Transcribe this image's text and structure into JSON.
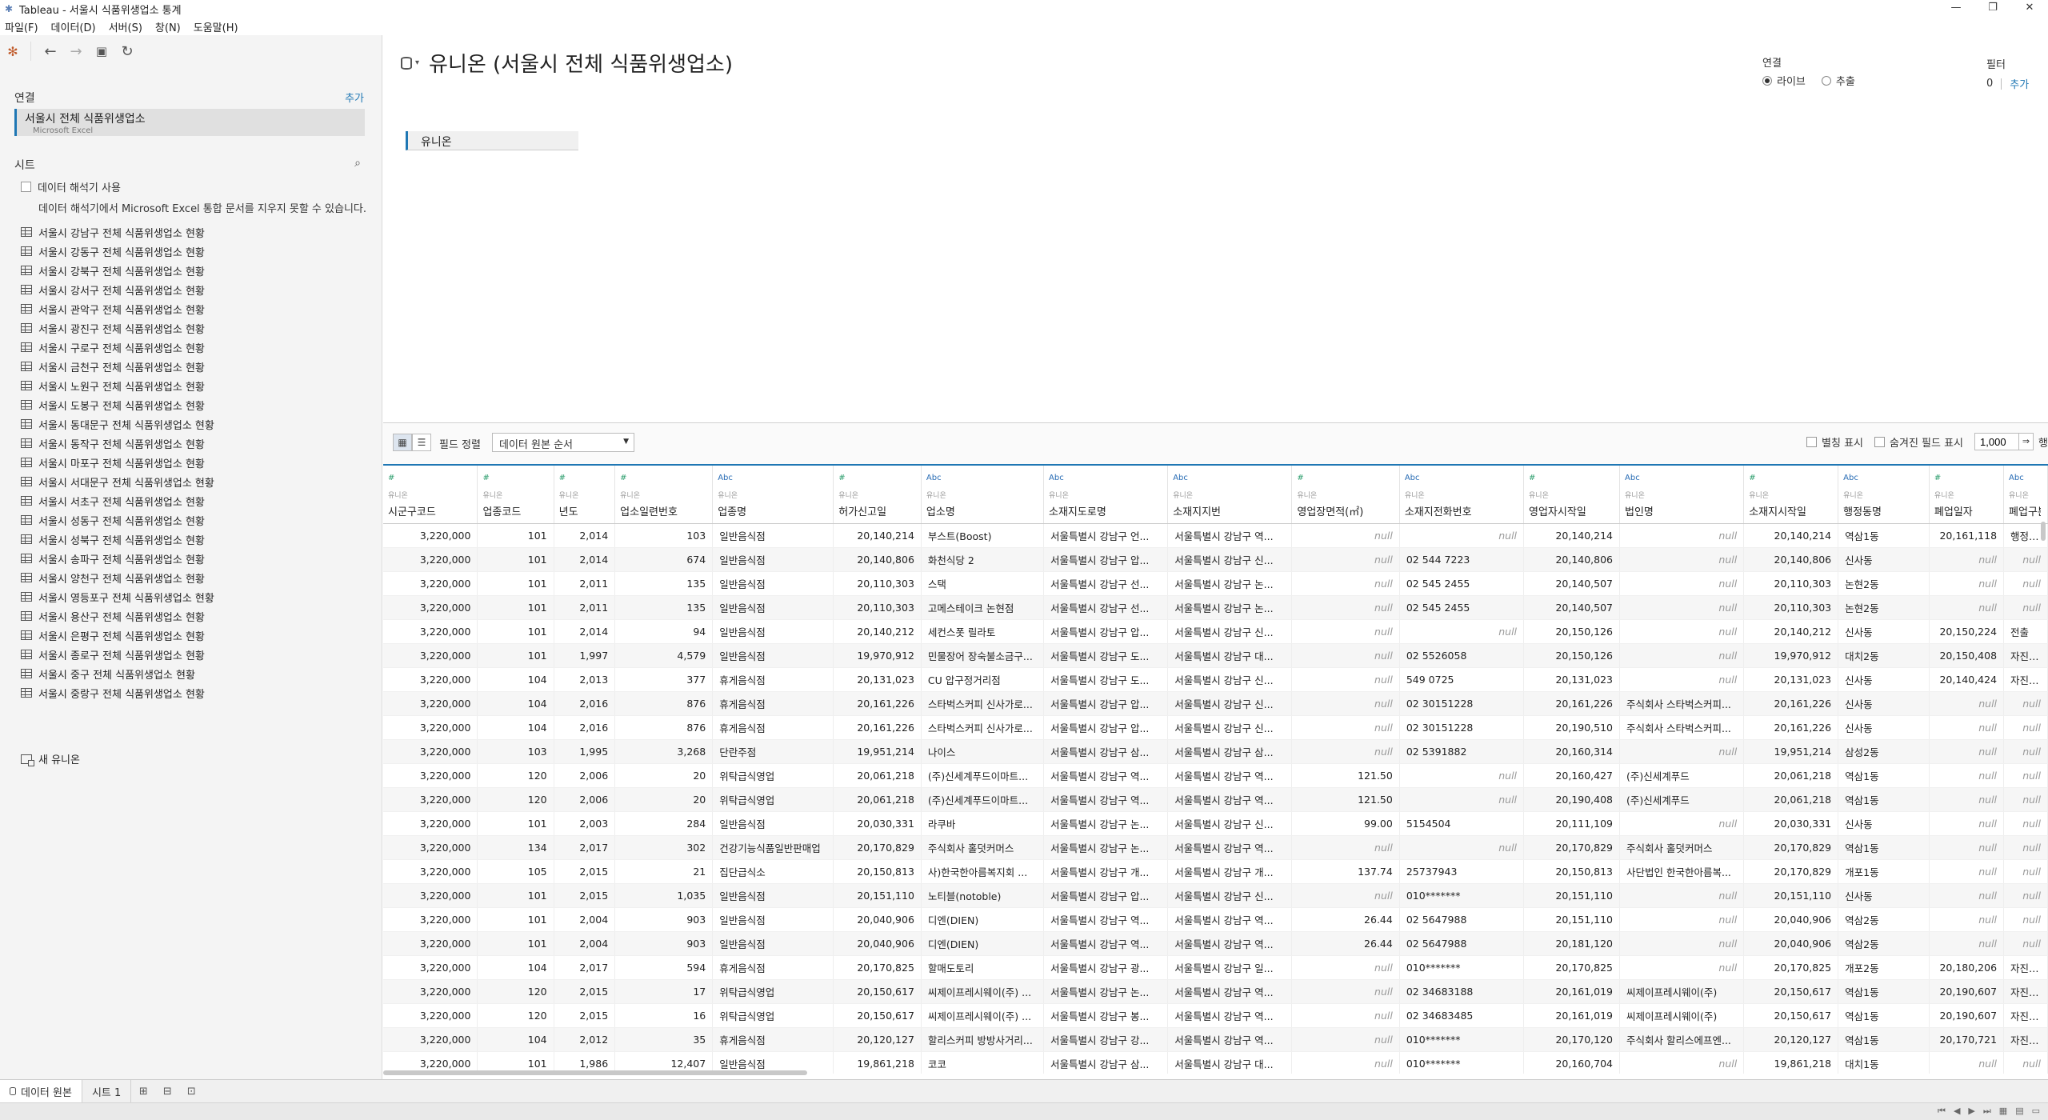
{
  "window": {
    "title": "Tableau - 서울시 식품위생업소 통계"
  },
  "menu": [
    "파일(F)",
    "데이터(D)",
    "서버(S)",
    "창(N)",
    "도움말(H)"
  ],
  "left": {
    "connections_header": "연결",
    "add_label": "추가",
    "connection": {
      "name": "서울시 전체 식품위생업소",
      "type": "Microsoft Excel"
    },
    "sheets_header": "시트",
    "interpreter_label": "데이터 해석기 사용",
    "interpreter_desc": "데이터 해석기에서 Microsoft Excel 통합 문서를 지우지 못할 수 있습니다.",
    "sheets": [
      "서울시 강남구 전체 식품위생업소 현황",
      "서울시 강동구 전체 식품위생업소 현황",
      "서울시 강북구 전체 식품위생업소 현황",
      "서울시 강서구 전체 식품위생업소 현황",
      "서울시 관악구 전체 식품위생업소 현황",
      "서울시 광진구 전체 식품위생업소 현황",
      "서울시 구로구 전체 식품위생업소 현황",
      "서울시 금천구 전체 식품위생업소 현황",
      "서울시 노원구 전체 식품위생업소 현황",
      "서울시 도봉구 전체 식품위생업소 현황",
      "서울시 동대문구 전체 식품위생업소 현황",
      "서울시 동작구 전체 식품위생업소 현황",
      "서울시 마포구 전체 식품위생업소 현황",
      "서울시 서대문구 전체 식품위생업소 현황",
      "서울시 서초구 전체 식품위생업소 현황",
      "서울시 성동구 전체 식품위생업소 현황",
      "서울시 성북구 전체 식품위생업소 현황",
      "서울시 송파구 전체 식품위생업소 현황",
      "서울시 양천구 전체 식품위생업소 현황",
      "서울시 영등포구 전체 식품위생업소 현황",
      "서울시 용산구 전체 식품위생업소 현황",
      "서울시 은평구 전체 식품위생업소 현황",
      "서울시 종로구 전체 식품위생업소 현황",
      "서울시 중구 전체 식품위생업소 현황",
      "서울시 중랑구 전체 식품위생업소 현황"
    ],
    "new_union": "새 유니온"
  },
  "canvas": {
    "title": "유니온 (서울시 전체 식품위생업소)",
    "connection_label": "연결",
    "live_label": "라이브",
    "extract_label": "추출",
    "filters_label": "필터",
    "filters_count": "0",
    "filters_add": "추가",
    "union_pill": "유니온"
  },
  "grid_toolbar": {
    "sort_label": "필드 정렬",
    "sort_value": "데이터 원본 순서",
    "show_alias": "별칭 표시",
    "show_hidden": "숨겨진 필드 표시",
    "rows_value": "1,000",
    "rows_label": "행"
  },
  "grid": {
    "columns": [
      {
        "type": "#",
        "source": "유니온",
        "name": "시군구코드"
      },
      {
        "type": "#",
        "source": "유니온",
        "name": "업종코드"
      },
      {
        "type": "#",
        "source": "유니온",
        "name": "년도"
      },
      {
        "type": "#",
        "source": "유니온",
        "name": "업소일련번호"
      },
      {
        "type": "Abc",
        "source": "유니온",
        "name": "업종명"
      },
      {
        "type": "#",
        "source": "유니온",
        "name": "허가신고일"
      },
      {
        "type": "Abc",
        "source": "유니온",
        "name": "업소명"
      },
      {
        "type": "Abc",
        "source": "유니온",
        "name": "소재지도로명"
      },
      {
        "type": "Abc",
        "source": "유니온",
        "name": "소재지지번"
      },
      {
        "type": "#",
        "source": "유니온",
        "name": "영업장면적(㎡)"
      },
      {
        "type": "Abc",
        "source": "유니온",
        "name": "소재지전화번호"
      },
      {
        "type": "#",
        "source": "유니온",
        "name": "영업자시작일"
      },
      {
        "type": "Abc",
        "source": "유니온",
        "name": "법인명"
      },
      {
        "type": "#",
        "source": "유니온",
        "name": "소재지시작일"
      },
      {
        "type": "Abc",
        "source": "유니온",
        "name": "행정동명"
      },
      {
        "type": "#",
        "source": "유니온",
        "name": "폐업일자"
      },
      {
        "type": "Abc",
        "source": "유니온",
        "name": "폐업구분"
      }
    ],
    "rows": [
      [
        "3,220,000",
        "101",
        "2,014",
        "103",
        "일반음식점",
        "20,140,214",
        "부스트(Boost)",
        "서울특별시 강남구 언...",
        "서울특별시 강남구 역...",
        "null",
        "null",
        "20,140,214",
        "null",
        "20,140,214",
        "역삼1동",
        "20,161,118",
        "행정처분"
      ],
      [
        "3,220,000",
        "101",
        "2,014",
        "674",
        "일반음식점",
        "20,140,806",
        "화천식당 2",
        "서울특별시 강남구 압...",
        "서울특별시 강남구 신...",
        "null",
        "02 544 7223",
        "20,140,806",
        "null",
        "20,140,806",
        "신사동",
        "null",
        "null"
      ],
      [
        "3,220,000",
        "101",
        "2,011",
        "135",
        "일반음식점",
        "20,110,303",
        "스택",
        "서울특별시 강남구 선...",
        "서울특별시 강남구 논...",
        "null",
        "02 545 2455",
        "20,140,507",
        "null",
        "20,110,303",
        "논현2동",
        "null",
        "null"
      ],
      [
        "3,220,000",
        "101",
        "2,011",
        "135",
        "일반음식점",
        "20,110,303",
        "고메스테이크 논현점",
        "서울특별시 강남구 선...",
        "서울특별시 강남구 논...",
        "null",
        "02 545 2455",
        "20,140,507",
        "null",
        "20,110,303",
        "논현2동",
        "null",
        "null"
      ],
      [
        "3,220,000",
        "101",
        "2,014",
        "94",
        "일반음식점",
        "20,140,212",
        "세컨스폿 릴라토",
        "서울특별시 강남구 압...",
        "서울특별시 강남구 신...",
        "null",
        "null",
        "20,150,126",
        "null",
        "20,140,212",
        "신사동",
        "20,150,224",
        "전출"
      ],
      [
        "3,220,000",
        "101",
        "1,997",
        "4,579",
        "일반음식점",
        "19,970,912",
        "민물장어 장숙불소금구...",
        "서울특별시 강남구 도...",
        "서울특별시 강남구 대...",
        "null",
        "02 5526058",
        "20,150,126",
        "null",
        "19,970,912",
        "대치2동",
        "20,150,408",
        "자진폐업"
      ],
      [
        "3,220,000",
        "104",
        "2,013",
        "377",
        "휴게음식점",
        "20,131,023",
        "CU 압구정거리점",
        "서울특별시 강남구 도...",
        "서울특별시 강남구 신...",
        "null",
        "549 0725",
        "20,131,023",
        "null",
        "20,131,023",
        "신사동",
        "20,140,424",
        "자진폐업"
      ],
      [
        "3,220,000",
        "104",
        "2,016",
        "876",
        "휴게음식점",
        "20,161,226",
        "스타벅스커피 신사가로...",
        "서울특별시 강남구 압...",
        "서울특별시 강남구 신...",
        "null",
        "02  30151228",
        "20,161,226",
        "주식회사 스타벅스커피...",
        "20,161,226",
        "신사동",
        "null",
        "null"
      ],
      [
        "3,220,000",
        "104",
        "2,016",
        "876",
        "휴게음식점",
        "20,161,226",
        "스타벅스커피 신사가로...",
        "서울특별시 강남구 압...",
        "서울특별시 강남구 신...",
        "null",
        "02  30151228",
        "20,190,510",
        "주식회사 스타벅스커피...",
        "20,161,226",
        "신사동",
        "null",
        "null"
      ],
      [
        "3,220,000",
        "103",
        "1,995",
        "3,268",
        "단란주점",
        "19,951,214",
        "나이스",
        "서울특별시 강남구 삼...",
        "서울특별시 강남구 삼...",
        "null",
        "02  5391882",
        "20,160,314",
        "null",
        "19,951,214",
        "삼성2동",
        "null",
        "null"
      ],
      [
        "3,220,000",
        "120",
        "2,006",
        "20",
        "위탁급식영업",
        "20,061,218",
        "(주)신세계푸드이마트...",
        "서울특별시 강남구 역...",
        "서울특별시 강남구 역...",
        "121.50",
        "null",
        "20,160,427",
        "(주)신세계푸드",
        "20,061,218",
        "역삼1동",
        "null",
        "null"
      ],
      [
        "3,220,000",
        "120",
        "2,006",
        "20",
        "위탁급식영업",
        "20,061,218",
        "(주)신세계푸드이마트...",
        "서울특별시 강남구 역...",
        "서울특별시 강남구 역...",
        "121.50",
        "null",
        "20,190,408",
        "(주)신세계푸드",
        "20,061,218",
        "역삼1동",
        "null",
        "null"
      ],
      [
        "3,220,000",
        "101",
        "2,003",
        "284",
        "일반음식점",
        "20,030,331",
        "라쿠바",
        "서울특별시 강남구 논...",
        "서울특별시 강남구 신...",
        "99.00",
        "5154504",
        "20,111,109",
        "null",
        "20,030,331",
        "신사동",
        "null",
        "null"
      ],
      [
        "3,220,000",
        "134",
        "2,017",
        "302",
        "건강기능식품일반판매업",
        "20,170,829",
        "주식회사 홀덧커머스",
        "서울특별시 강남구 논...",
        "서울특별시 강남구 역...",
        "null",
        "null",
        "20,170,829",
        "주식회사 홀덧커머스",
        "20,170,829",
        "역삼1동",
        "null",
        "null"
      ],
      [
        "3,220,000",
        "105",
        "2,015",
        "21",
        "집단급식소",
        "20,150,813",
        "사)한국한아름복지회 ...",
        "서울특별시 강남구 개...",
        "서울특별시 강남구 개...",
        "137.74",
        "25737943",
        "20,150,813",
        "사단법인 한국한아름복...",
        "20,170,829",
        "개포1동",
        "null",
        "null"
      ],
      [
        "3,220,000",
        "101",
        "2,015",
        "1,035",
        "일반음식점",
        "20,151,110",
        "노티블(notoble)",
        "서울특별시 강남구 압...",
        "서울특별시 강남구 신...",
        "null",
        "010*******",
        "20,151,110",
        "null",
        "20,151,110",
        "신사동",
        "null",
        "null"
      ],
      [
        "3,220,000",
        "101",
        "2,004",
        "903",
        "일반음식점",
        "20,040,906",
        "디엔(DIEN)",
        "서울특별시 강남구 역...",
        "서울특별시 강남구 역...",
        "26.44",
        "02  5647988",
        "20,151,110",
        "null",
        "20,040,906",
        "역삼2동",
        "null",
        "null"
      ],
      [
        "3,220,000",
        "101",
        "2,004",
        "903",
        "일반음식점",
        "20,040,906",
        "디엔(DIEN)",
        "서울특별시 강남구 역...",
        "서울특별시 강남구 역...",
        "26.44",
        "02  5647988",
        "20,181,120",
        "null",
        "20,040,906",
        "역삼2동",
        "null",
        "null"
      ],
      [
        "3,220,000",
        "104",
        "2,017",
        "594",
        "휴게음식점",
        "20,170,825",
        "할매도토리",
        "서울특별시 강남구 광...",
        "서울특별시 강남구 일...",
        "null",
        "010*******",
        "20,170,825",
        "null",
        "20,170,825",
        "개포2동",
        "20,180,206",
        "자진폐업"
      ],
      [
        "3,220,000",
        "120",
        "2,015",
        "17",
        "위탁급식영업",
        "20,150,617",
        "씨제이프레시웨이(주) ...",
        "서울특별시 강남구 논...",
        "서울특별시 강남구 역...",
        "null",
        "02  34683188",
        "20,161,019",
        "씨제이프레시웨이(주)",
        "20,150,617",
        "역삼1동",
        "20,190,607",
        "자진폐업"
      ],
      [
        "3,220,000",
        "120",
        "2,015",
        "16",
        "위탁급식영업",
        "20,150,617",
        "씨제이프레시웨이(주) ...",
        "서울특별시 강남구 봉...",
        "서울특별시 강남구 역...",
        "null",
        "02  34683485",
        "20,161,019",
        "씨제이프레시웨이(주)",
        "20,150,617",
        "역삼1동",
        "20,190,607",
        "자진폐업"
      ],
      [
        "3,220,000",
        "104",
        "2,012",
        "35",
        "휴게음식점",
        "20,120,127",
        "할리스커피 방방사거리...",
        "서울특별시 강남구 강...",
        "서울특별시 강남구 역...",
        "null",
        "010*******",
        "20,170,120",
        "주식회사 할리스에프엔...",
        "20,120,127",
        "역삼1동",
        "20,170,721",
        "자진폐업"
      ],
      [
        "3,220,000",
        "101",
        "1,986",
        "12,407",
        "일반음식점",
        "19,861,218",
        "코코",
        "서울특별시 강남구 삼...",
        "서울특별시 강남구 대...",
        "null",
        "010*******",
        "20,160,704",
        "null",
        "19,861,218",
        "대치1동",
        "null",
        "null"
      ]
    ]
  },
  "bottom": {
    "datasource_tab": "데이터 원본",
    "sheet_tab": "시트 1"
  }
}
